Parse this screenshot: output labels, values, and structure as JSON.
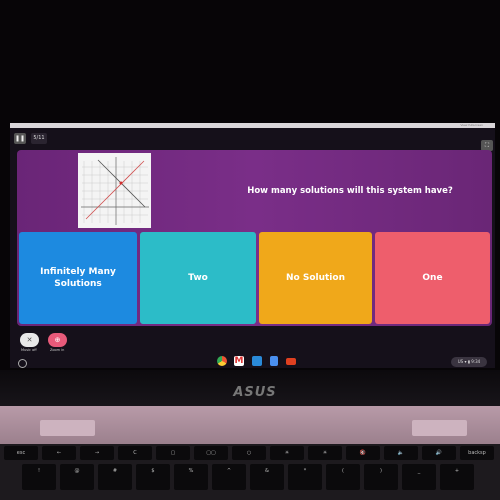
{
  "top_bar": {
    "text": "View fullscreen"
  },
  "quiz": {
    "counter": "5/11",
    "question": "How many solutions will this system have?",
    "answers": [
      {
        "label": "Infinitely Many Solutions",
        "color": "#1d8ae0"
      },
      {
        "label": "Two",
        "color": "#2cbcc8"
      },
      {
        "label": "No Solution",
        "color": "#f0a81a"
      },
      {
        "label": "One",
        "color": "#ee5e6c"
      }
    ]
  },
  "controls": {
    "music_label": "Music off",
    "zoom_label": "Zoom in"
  },
  "taskbar": {
    "apps": [
      "chrome-icon",
      "gmail-icon",
      "files-icon",
      "docs-icon",
      "youtube-icon"
    ],
    "tray": "US ▾ ▮ 9:34"
  },
  "laptop": {
    "brand": "ASUS"
  },
  "keyboard": {
    "keys": [
      "esc",
      "←",
      "→",
      "C",
      "▢",
      "▢▢",
      "○",
      "☀",
      "☀",
      "🔇",
      "🔈",
      "🔊",
      "backsp"
    ],
    "row2": [
      "!",
      "@",
      "#",
      "$",
      "%",
      "^",
      "&",
      "*",
      "(",
      ")",
      "_",
      "+"
    ]
  }
}
